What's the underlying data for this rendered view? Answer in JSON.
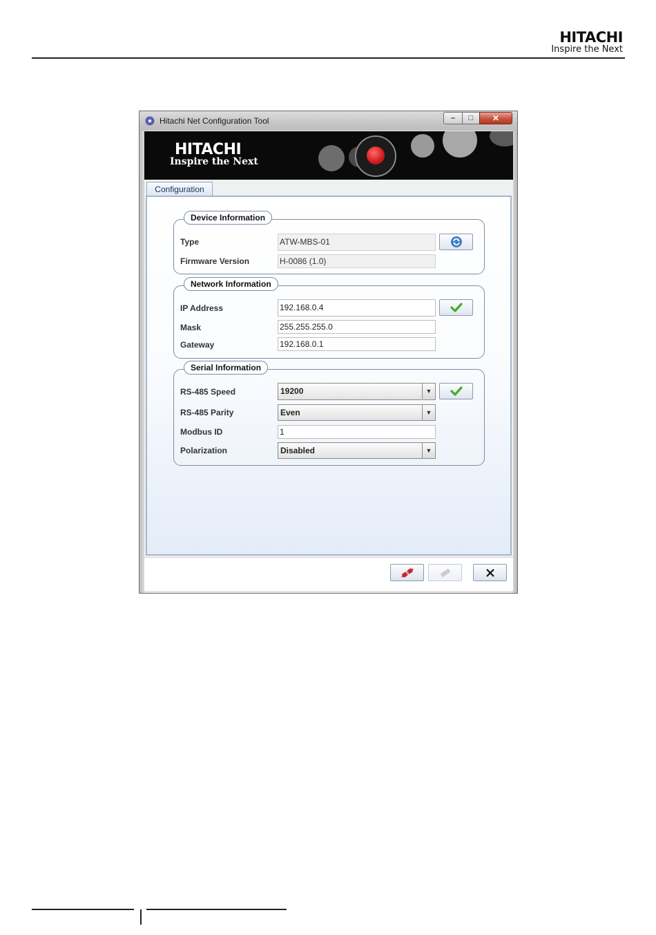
{
  "page": {
    "brand_wordmark": "HITACHI",
    "brand_tagline": "Inspire the Next"
  },
  "window": {
    "title": "Hitachi Net Configuration Tool",
    "controls": {
      "minimize": "–",
      "maximize": "□",
      "close": "✕"
    },
    "banner": {
      "wordmark": "HITACHI",
      "tagline": "Inspire the Next"
    },
    "tabs": [
      {
        "label": "Configuration"
      }
    ],
    "device_info": {
      "legend": "Device Information",
      "type_label": "Type",
      "type_value": "ATW-MBS-01",
      "firmware_label": "Firmware Version",
      "firmware_value": "H-0086 (1.0)",
      "refresh_icon": "refresh-icon"
    },
    "network_info": {
      "legend": "Network Information",
      "ip_label": "IP Address",
      "ip_value": "192.168.0.4",
      "mask_label": "Mask",
      "mask_value": "255.255.255.0",
      "gateway_label": "Gateway",
      "gateway_value": "192.168.0.1",
      "apply_icon": "checkmark-icon"
    },
    "serial_info": {
      "legend": "Serial Information",
      "speed_label": "RS-485 Speed",
      "speed_value": "19200",
      "parity_label": "RS-485 Parity",
      "parity_value": "Even",
      "modbus_label": "Modbus ID",
      "modbus_value": "1",
      "polarization_label": "Polarization",
      "polarization_value": "Disabled",
      "apply_icon": "checkmark-icon"
    },
    "bottom_buttons": {
      "connect_icon": "plug-connect-icon",
      "disconnect_icon": "plug-disconnect-icon",
      "close_icon": "close-x-icon"
    },
    "colors": {
      "accent_red": "#d42020",
      "check_green": "#3fae2a",
      "refresh_blue": "#3c7fc4"
    }
  }
}
